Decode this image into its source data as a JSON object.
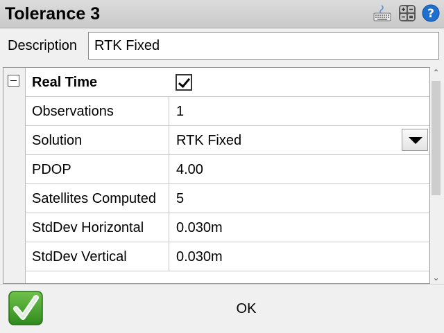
{
  "window": {
    "title": "Tolerance 3"
  },
  "toolbar_icons": [
    "keyboard-icon",
    "calculator-icon",
    "help-icon"
  ],
  "description": {
    "label": "Description",
    "value": "RTK Fixed"
  },
  "grid": {
    "section_label": "Real Time",
    "section_checked": true,
    "rows": [
      {
        "name": "Observations",
        "value": "1"
      },
      {
        "name": "Solution",
        "value": "RTK Fixed"
      },
      {
        "name": "PDOP",
        "value": "4.00"
      },
      {
        "name": "Satellites Computed",
        "value": "5"
      },
      {
        "name": "StdDev Horizontal",
        "value": "0.030m"
      },
      {
        "name": "StdDev Vertical",
        "value": "0.030m"
      }
    ]
  },
  "footer": {
    "ok_label": "OK"
  },
  "colors": {
    "titlebar": "#d3d3d3",
    "ok_green": "#3f9a2a"
  }
}
